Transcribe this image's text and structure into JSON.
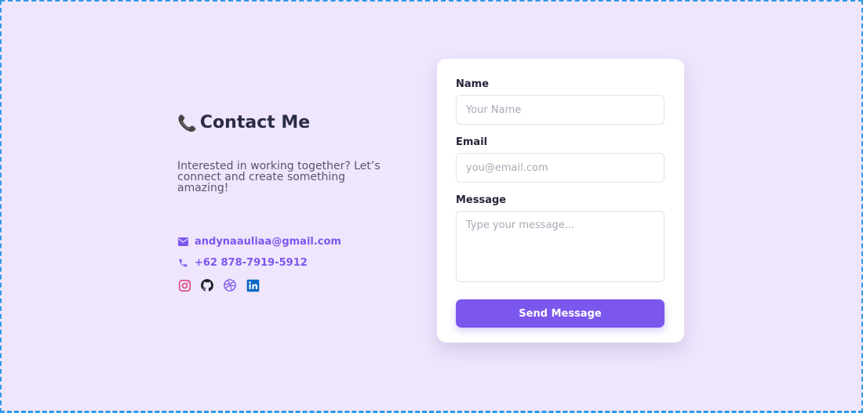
{
  "contact": {
    "title": "Contact Me",
    "title_icon": "phone-icon",
    "description": "Interested in working together? Let’s connect and create something amazing!",
    "email": "andynaauliaa@gmail.com",
    "phone": "+62 878-7919-5912",
    "accent_color": "#7b57ee",
    "socials": [
      {
        "name": "instagram-icon",
        "color": "#e1306c"
      },
      {
        "name": "github-icon",
        "color": "#1b1f23"
      },
      {
        "name": "dribbble-icon",
        "color": "#7b57ee"
      },
      {
        "name": "linkedin-icon",
        "color": "#0a66c2"
      }
    ]
  },
  "form": {
    "name_label": "Name",
    "name_placeholder": "Your Name",
    "email_label": "Email",
    "email_placeholder": "you@email.com",
    "message_label": "Message",
    "message_placeholder": "Type your message...",
    "submit_label": "Send Message"
  }
}
